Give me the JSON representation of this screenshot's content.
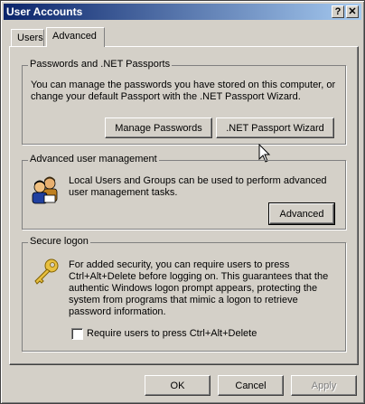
{
  "window": {
    "title": "User Accounts",
    "help_label": "?",
    "close_label": "✕"
  },
  "tabs": [
    {
      "label": "Users"
    },
    {
      "label": "Advanced"
    }
  ],
  "passwords": {
    "heading": "Passwords and .NET Passports",
    "description_1": "You can manage the passwords you have stored on this computer, or",
    "description_2": "change your default Passport with the .NET Passport Wizard.",
    "manage_button": "Manage Passwords",
    "wizard_button": ".NET Passport Wizard"
  },
  "advanced_mgmt": {
    "heading": "Advanced user management",
    "description_1": "Local Users and Groups can be used to perform advanced",
    "description_2": "user management tasks.",
    "button": "Advanced",
    "icon": "users-group-icon"
  },
  "secure_logon": {
    "heading": "Secure logon",
    "lines": [
      "For added security, you can require users to press",
      "Ctrl+Alt+Delete before logging on. This guarantees that the",
      "authentic Windows logon prompt appears, protecting the",
      "system from programs that mimic a logon to retrieve",
      "password information."
    ],
    "checkbox_label": "Require users to press Ctrl+Alt+Delete",
    "checkbox_checked": false,
    "icon": "key-icon"
  },
  "footer": {
    "ok": "OK",
    "cancel": "Cancel",
    "apply": "Apply"
  }
}
